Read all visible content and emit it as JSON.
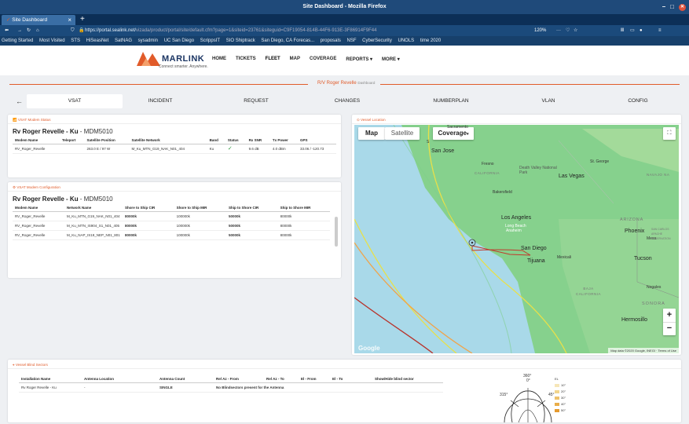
{
  "window": {
    "title": "Site Dashboard - Mozilla Firefox"
  },
  "browser": {
    "tab_title": "Site Dashboard",
    "url_prefix": "https://portal.sealink.net/",
    "url_rest": "vizada/product/portal/site/default.cfm?page=1&siteid=23761&siteguid=C9F19054-814B-44F6-913E-3F86914F9F44",
    "zoom": "120%",
    "bookmarks": [
      "Getting Started",
      "Most Visited",
      "STS",
      "HiSeasNet",
      "SatNAG",
      "sysadmin",
      "UC San Diego",
      "ScrippsIT",
      "SIO Shiptrack",
      "San Diego, CA Forecas...",
      "proposals",
      "NSF",
      "CyberSecurity",
      "UNOLS",
      "time 2020"
    ]
  },
  "site": {
    "logo_name": "MARLINK",
    "logo_tagline": "Connect smarter. Anywhere.",
    "nav": [
      "HOME",
      "TICKETS",
      "FLEET",
      "MAP",
      "COVERAGE",
      "REPORTS ▾",
      "MORE ▾"
    ],
    "vessel_title": "R/V Roger Revelle",
    "vessel_subtitle": "Dashboard"
  },
  "tabs": [
    "VSAT",
    "INCIDENT",
    "REQUEST",
    "CHANGES",
    "NUMBERPLAN",
    "VLAN",
    "CONFIG"
  ],
  "modem_status": {
    "header": "VSAT Modem Status",
    "title_bold": "Rv Roger Revelle - Ku",
    "title_light": " - MDM5010",
    "columns": [
      "Modem Name",
      "Teleport",
      "Satellite Position",
      "Satellite Network",
      "Band",
      "Status",
      "Rx SNR",
      "Tx Power",
      "GPS"
    ],
    "rows": [
      [
        "RV_Roger_Revelle",
        "",
        "263.0 E / 97 W",
        "M_Ku_MTN_G19_NAK_N01_404",
        "Ku",
        "✓",
        "9.6 dB",
        "4.0 dBm",
        "33.06 / -120.73"
      ]
    ]
  },
  "modem_config": {
    "header": "VSAT Modem Configuration",
    "title_bold": "Rv Roger Revelle - Ku",
    "title_light": " - MDM5010",
    "columns": [
      "Modem Name",
      "Network Name",
      "Shore to Ship CIR",
      "Shore to Ship MIR",
      "Ship to Shore CIR",
      "Ship to Shore MIR"
    ],
    "rows": [
      [
        "RV_Roger_Revelle",
        "M_Ku_MTN_G19_NAK_N01_404",
        "80000k",
        "100000k",
        "50000k",
        "80000k"
      ],
      [
        "RV_Roger_Revelle",
        "M_Ku_MTN_IS904_S1_N01_405",
        "80000k",
        "100000k",
        "50000k",
        "80000k"
      ],
      [
        "RV_Roger_Revelle",
        "M_Ku_NAP_IS19_NEP_N01_801",
        "80000k",
        "100000k",
        "50000k",
        "80000k"
      ]
    ]
  },
  "map": {
    "header": "Vessel Location",
    "type_map": "Map",
    "type_satellite": "Satellite",
    "coverage": "Coverage",
    "labels": {
      "sacramento": "Sacramento",
      "san_jose": "San Jose",
      "sf": "S",
      "fresno": "Fresno",
      "california": "CALIFORNIA",
      "death_valley": "Death Valley National Park",
      "las_vegas": "Las Vegas",
      "st_george": "St. George",
      "bakersfield": "Bakersfield",
      "navajo": "NAVAJO NA",
      "los_angeles": "Los Angeles",
      "anaheim": "Anaheim",
      "long_beach": "Long Beach",
      "arizona": "ARIZONA",
      "phoenix": "Phoenix",
      "mesa": "Mesa",
      "san_carlos": "SAN CARLOS APACHE RESERVATION",
      "san_diego": "San Diego",
      "tijuana": "Tijuana",
      "mexicali": "Mexicali",
      "tucson": "Tucson",
      "baja": "BAJA CALIFORNIA",
      "nogales": "Nogales",
      "sonora": "SONORA",
      "hermosillo": "Hermosillo"
    },
    "google": "Google",
    "copyright": "Map data ©2020 Google, INEGI",
    "terms": "Terms of Use",
    "zoom_in": "+",
    "zoom_out": "−"
  },
  "blind_sectors": {
    "header": "Vessel Blind Sectors",
    "columns": [
      "Installation Name",
      "Antenna Location",
      "Antenna Count",
      "Rel Az - From",
      "Rel Az - To",
      "El - From",
      "El - To",
      "Show/Hide blind sector"
    ],
    "rows": [
      [
        "Rv Roger Revelle - Ku",
        "-",
        "SINGLE",
        "No Blindsectors present for the Antenna",
        "",
        "",
        "",
        ""
      ]
    ],
    "polar_labels": [
      "360°",
      "0°",
      "315°",
      "45°"
    ],
    "elevation_legend": [
      "EL",
      "10°",
      "20°",
      "30°",
      "40°",
      "50°"
    ]
  },
  "colors": {
    "accent": "#e15b2a",
    "titlebar": "#1f4a7a",
    "map_land": "#7fcf8a",
    "coverage_yellow": "#e8e04a",
    "coverage_orange": "#f0a44a",
    "coverage_red": "#b8322a"
  }
}
